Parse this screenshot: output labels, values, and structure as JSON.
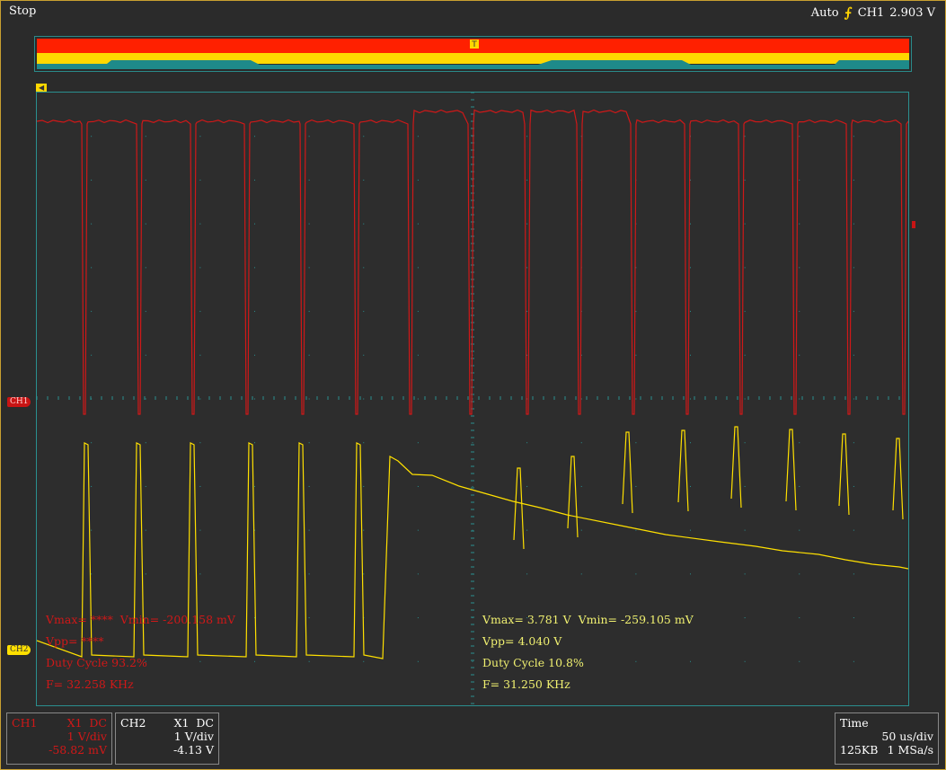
{
  "status": "Stop",
  "trigger": {
    "mode": "Auto",
    "icon": "rising-edge-icon",
    "source": "CH1",
    "level": "2.903 V"
  },
  "markers": {
    "trigger_time_marker": "T",
    "ch1": "CH1",
    "ch2": "CH2"
  },
  "colors": {
    "ch1": "#d01818",
    "ch2": "#ffe000",
    "grid": "#2a9090",
    "overview_bar": "#ff2000"
  },
  "measurements_ch1": {
    "vmax": "Vmax= ****",
    "vmin": "Vmin= -200.158 mV",
    "vpp": "Vpp= ****",
    "duty": "Duty Cycle 93.2%",
    "freq": "F= 32.258 KHz"
  },
  "measurements_ch2": {
    "vmax": "Vmax= 3.781 V",
    "vmin": "Vmin= -259.105 mV",
    "vpp": "Vpp= 4.040 V",
    "duty": "Duty Cycle 10.8%",
    "freq": "F= 31.250 KHz"
  },
  "panel_ch1": {
    "name": "CH1",
    "probe": "X1",
    "coupling": "DC",
    "scale": "1 V/div",
    "offset": "-58.82 mV"
  },
  "panel_ch2": {
    "name": "CH2",
    "probe": "X1",
    "coupling": "DC",
    "scale": "1 V/div",
    "offset": "-4.13 V"
  },
  "panel_time": {
    "label": "Time",
    "scale": "50 us/div",
    "memory": "125KB",
    "rate": "1 MSa/s"
  }
}
